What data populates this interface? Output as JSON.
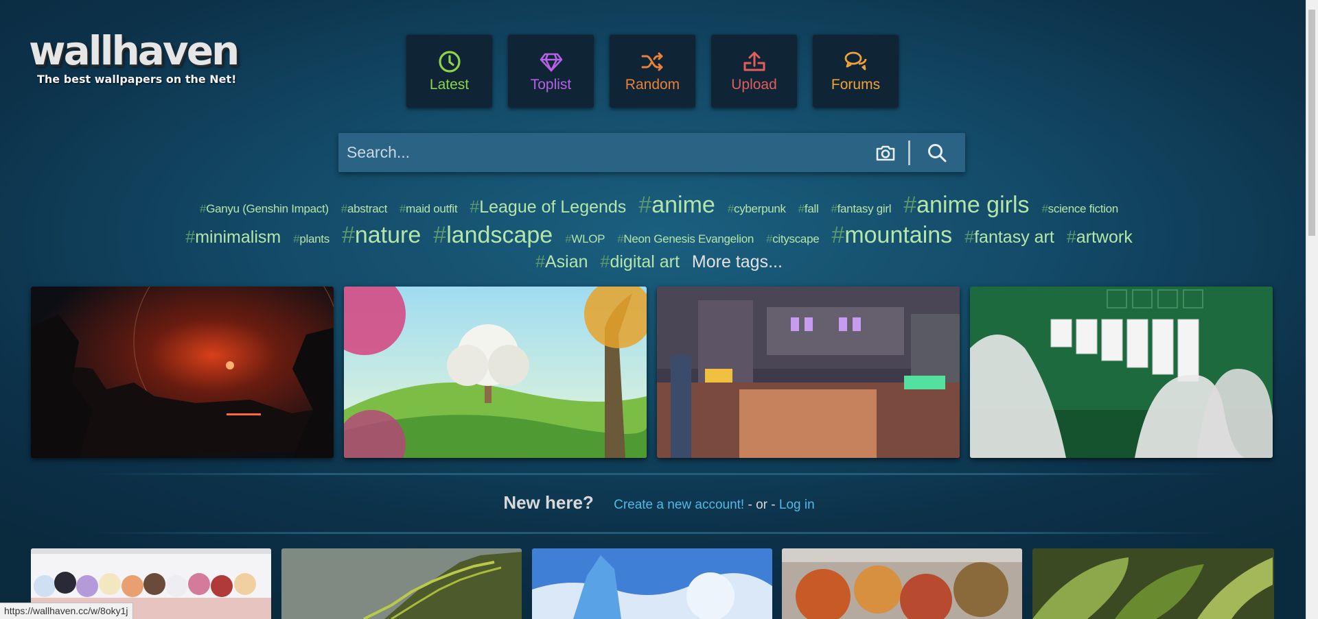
{
  "logo": {
    "text": "wallhaven",
    "tagline": "The best wallpapers on the Net!"
  },
  "nav": [
    {
      "label": "Latest",
      "icon": "clock-icon",
      "color": "#8fd34b"
    },
    {
      "label": "Toplist",
      "icon": "diamond-icon",
      "color": "#b562e6"
    },
    {
      "label": "Random",
      "icon": "shuffle-icon",
      "color": "#e8813a"
    },
    {
      "label": "Upload",
      "icon": "upload-icon",
      "color": "#e35d5d"
    },
    {
      "label": "Forums",
      "icon": "chat-icon",
      "color": "#f0a338"
    }
  ],
  "search": {
    "placeholder": "Search..."
  },
  "tags": {
    "row1": [
      {
        "name": "Ganyu (Genshin Impact)",
        "size": "s"
      },
      {
        "name": "abstract",
        "size": "s"
      },
      {
        "name": "maid outfit",
        "size": "s"
      },
      {
        "name": "League of Legends",
        "size": "m"
      },
      {
        "name": "anime",
        "size": "l"
      },
      {
        "name": "cyberpunk",
        "size": "s"
      },
      {
        "name": "fall",
        "size": "s"
      },
      {
        "name": "fantasy girl",
        "size": "s"
      },
      {
        "name": "anime girls",
        "size": "l"
      },
      {
        "name": "science fiction",
        "size": "s"
      }
    ],
    "row2": [
      {
        "name": "minimalism",
        "size": "m"
      },
      {
        "name": "plants",
        "size": "s"
      },
      {
        "name": "nature",
        "size": "l"
      },
      {
        "name": "landscape",
        "size": "l"
      },
      {
        "name": "WLOP",
        "size": "s"
      },
      {
        "name": "Neon Genesis Evangelion",
        "size": "s"
      },
      {
        "name": "cityscape",
        "size": "s"
      },
      {
        "name": "mountains",
        "size": "l"
      },
      {
        "name": "fantasy art",
        "size": "m"
      },
      {
        "name": "artwork",
        "size": "m"
      }
    ],
    "row3": [
      {
        "name": "Asian",
        "size": "m"
      },
      {
        "name": "digital art",
        "size": "m"
      }
    ],
    "more": "More tags..."
  },
  "newhere": {
    "title": "New here?",
    "create": "Create a new account!",
    "or": " - or - ",
    "login": "Log in"
  },
  "featured": [
    {
      "name": "featured-space-landscape"
    },
    {
      "name": "featured-tree-meadow"
    },
    {
      "name": "featured-pixel-city"
    },
    {
      "name": "featured-solitaire"
    }
  ],
  "status": {
    "url": "https://wallhaven.cc/w/8oky1j"
  }
}
